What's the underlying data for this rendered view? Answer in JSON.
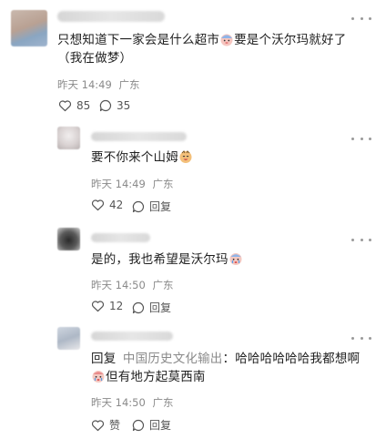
{
  "main_comment": {
    "text_line1": "只想知道下一家会是什么超市",
    "text_line1_b": "要是个沃尔玛就好了",
    "text_line2": "（我在做梦）",
    "time": "昨天 14:49",
    "location": "广东",
    "likes": "85",
    "replies": "35"
  },
  "replies": [
    {
      "text": "要不你来个山姆",
      "time": "昨天 14:49",
      "location": "广东",
      "likes": "42",
      "reply_label": "回复"
    },
    {
      "text": "是的，我也希望是沃尔玛",
      "time": "昨天 14:50",
      "location": "广东",
      "likes": "12",
      "reply_label": "回复"
    },
    {
      "reply_prefix": "回复",
      "reply_target": "中国历史文化输出",
      "text_line1": "：哈哈哈哈哈哈我都想啊",
      "text_line2": "但有地方起莫西南",
      "time": "昨天 14:50",
      "location": "广东",
      "likes": "赞",
      "reply_label": "回复"
    }
  ],
  "colors": {
    "text": "#1f1f1f",
    "meta": "#8a8a8a",
    "link": "#7a7a7a"
  }
}
